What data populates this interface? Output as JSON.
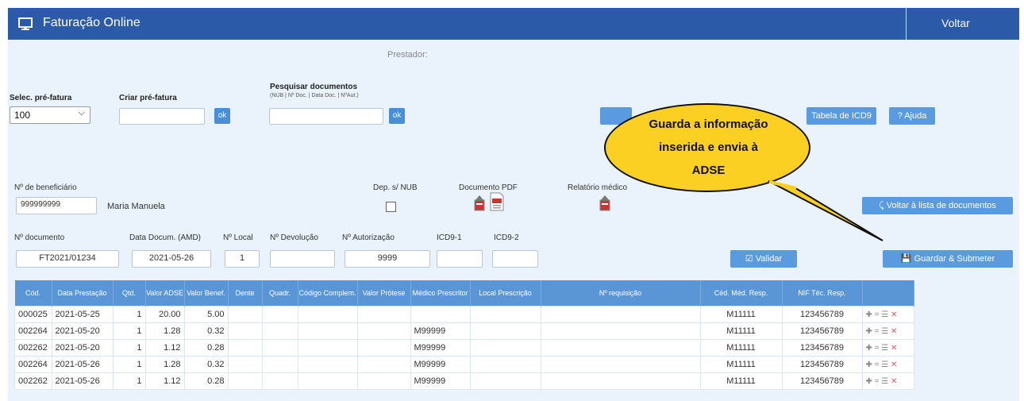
{
  "header": {
    "title": "Faturação Online",
    "back": "Voltar"
  },
  "prestador_label": "Prestador:",
  "selec": {
    "label": "Selec. pré-fatura",
    "value": "100"
  },
  "criar": {
    "label": "Criar pré-fatura",
    "ok": "ok"
  },
  "pesquisar": {
    "label": "Pesquisar documentos",
    "sub": "(NUB | Nº Doc. | Data Doc. | NºAut.)",
    "ok": "ok"
  },
  "topbuttons": {
    "tabela": "Tabela de ICD9",
    "ajuda": "? Ajuda"
  },
  "callout": {
    "line1": "Guarda a informação",
    "line2": "inserida e envia à",
    "line3": "ADSE"
  },
  "beneficiario": {
    "label": "Nº de beneficiário",
    "value": "999999999",
    "name": "Maria Manuela"
  },
  "dep_label": "Dep. s/ NUB",
  "pdf_label": "Documento PDF",
  "relatorio_label": "Relatório médico",
  "voltar_lista": "Voltar à lista de documentos",
  "doc": {
    "nd_label": "Nº documento",
    "nd_value": "FT2021/01234",
    "data_label": "Data Docum. (AMD)",
    "data_value": "2021-05-26",
    "local_label": "Nº Local",
    "local_value": "1",
    "dev_label": "Nº Devolução",
    "aut_label": "Nº Autorização",
    "aut_value": "9999",
    "icd1_label": "ICD9-1",
    "icd2_label": "ICD9-2"
  },
  "actions": {
    "validar": "Validar",
    "guardar": "Guardar & Submeter"
  },
  "table": {
    "headers": [
      "Cód.",
      "Data Prestação",
      "Qtd.",
      "Valor ADSE",
      "Valor Benef.",
      "Dente",
      "Quadr.",
      "Código Complem.",
      "Valor Prótese",
      "Médico Prescritor",
      "Local Prescrição",
      "Nº requisição",
      "Céd. Méd. Resp.",
      "NIF Téc. Resp.",
      ""
    ],
    "rows": [
      [
        "000025",
        "2021-05-25",
        "1",
        "20.00",
        "5.00",
        "",
        "",
        "",
        "",
        "",
        "",
        "",
        "M11111",
        "123456789"
      ],
      [
        "002264",
        "2021-05-20",
        "1",
        "1.28",
        "0.32",
        "",
        "",
        "",
        "",
        "M99999",
        "",
        "",
        "M11111",
        "123456789"
      ],
      [
        "002262",
        "2021-05-20",
        "1",
        "1.12",
        "0.28",
        "",
        "",
        "",
        "",
        "M99999",
        "",
        "",
        "M11111",
        "123456789"
      ],
      [
        "002264",
        "2021-05-26",
        "1",
        "1.28",
        "0.32",
        "",
        "",
        "",
        "",
        "M99999",
        "",
        "",
        "M11111",
        "123456789"
      ],
      [
        "002262",
        "2021-05-26",
        "1",
        "1.12",
        "0.28",
        "",
        "",
        "",
        "",
        "M99999",
        "",
        "",
        "M11111",
        "123456789"
      ]
    ]
  },
  "colors": {
    "header": "#2b5ba8",
    "button": "#5a9be0",
    "callout": "#fcd023"
  }
}
